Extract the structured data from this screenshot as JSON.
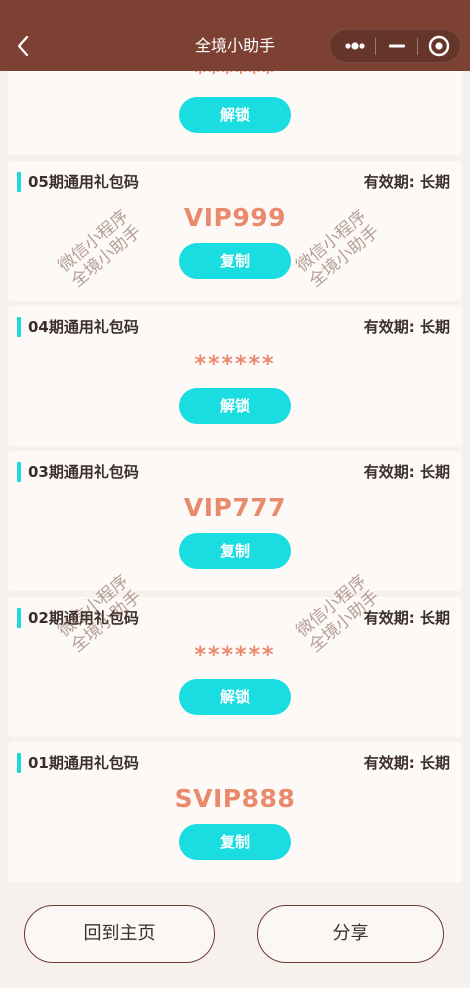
{
  "navbar": {
    "title": "全境小助手",
    "back_icon": "chevron-left-icon",
    "capsule_icons": [
      "more-dots-icon",
      "minimize-icon",
      "target-circle-icon"
    ]
  },
  "colors": {
    "navbar": "#7d4133",
    "accent": "#1fd8de",
    "button": "#19dde0",
    "code": "#ea8a6c",
    "text": "#3c2f2a"
  },
  "watermark": {
    "line1": "微信小程序",
    "line2": "全境小助手"
  },
  "top_partial": {
    "code": "******",
    "button": "解锁"
  },
  "cards": [
    {
      "title": "05期通用礼包码",
      "validity": "有效期: 长期",
      "code": "VIP999",
      "button": "复制"
    },
    {
      "title": "04期通用礼包码",
      "validity": "有效期: 长期",
      "code": "******",
      "button": "解锁"
    },
    {
      "title": "03期通用礼包码",
      "validity": "有效期: 长期",
      "code": "VIP777",
      "button": "复制"
    },
    {
      "title": "02期通用礼包码",
      "validity": "有效期: 长期",
      "code": "******",
      "button": "解锁"
    },
    {
      "title": "01期通用礼包码",
      "validity": "有效期: 长期",
      "code": "SVIP888",
      "button": "复制"
    }
  ],
  "bottom": {
    "home_label": "回到主页",
    "share_label": "分享"
  }
}
